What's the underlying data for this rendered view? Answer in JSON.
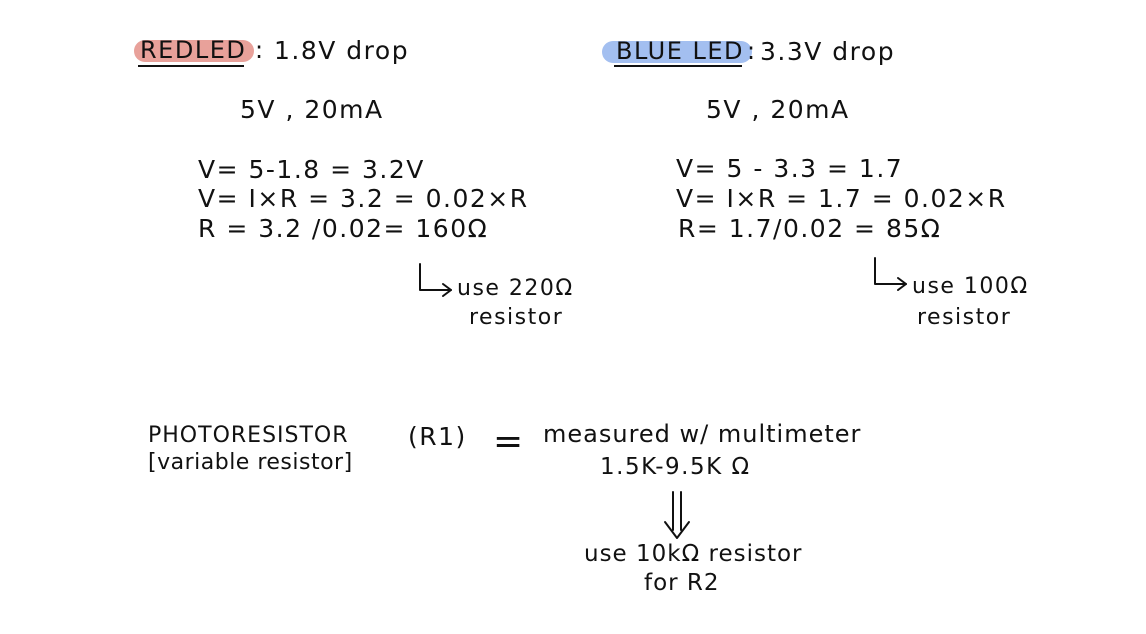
{
  "colors": {
    "red_highlight": "#e8a19a",
    "blue_highlight": "#a3bff0",
    "ink": "#111111"
  },
  "red_led": {
    "title": "REDLED",
    "colon": ":",
    "drop": "1.8V drop",
    "supply": "5V , 20mA",
    "eq1": "V= 5-1.8 = 3.2V",
    "eq2": "V= I×R = 3.2 = 0.02×R",
    "eq3": "R = 3.2 /0.02= 160Ω",
    "use_line1": "use 220Ω",
    "use_line2": "resistor"
  },
  "blue_led": {
    "title": "BLUE LED",
    "colon": ":",
    "drop": "3.3V drop",
    "supply": "5V , 20mA",
    "eq1": "V= 5 - 3.3 = 1.7",
    "eq2": "V= I×R = 1.7 = 0.02×R",
    "eq3": "R= 1.7/0.02 = 85Ω",
    "use_line1": "use 100Ω",
    "use_line2": "resistor"
  },
  "photoresistor": {
    "label": "PHOTORESISTOR",
    "sublabel": "[variable resistor]",
    "r1": "(R1)",
    "equals": "=",
    "measured": "measured w/ multimeter",
    "range": "1.5K-9.5K Ω",
    "use_line1": "use 10kΩ resistor",
    "use_line2": "for R2"
  },
  "icons": {
    "red_hook_arrow": "hook-right-arrow-icon",
    "blue_hook_arrow": "hook-right-arrow-icon",
    "double_down_arrow": "double-down-arrow-icon"
  }
}
